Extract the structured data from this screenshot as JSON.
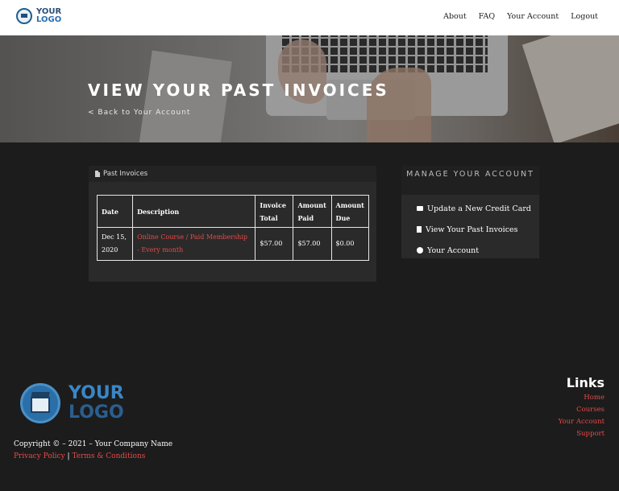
{
  "header": {
    "logo": {
      "line1": "YOUR",
      "line2": "LOGO"
    },
    "nav": [
      "About",
      "FAQ",
      "Your Account",
      "Logout"
    ]
  },
  "hero": {
    "title": "VIEW YOUR PAST INVOICES",
    "back_link": "< Back to Your Account"
  },
  "invoices": {
    "panel_title": "Past Invoices",
    "columns": {
      "date": "Date",
      "description": "Description",
      "invoice_total": "Invoice Total",
      "amount_paid": "Amount Paid",
      "amount_due": "Amount Due"
    },
    "rows": [
      {
        "date": "Dec 15, 2020",
        "description": "Online Course / Paid Membership - Every month",
        "invoice_total": "$57.00",
        "amount_paid": "$57.00",
        "amount_due": "$0.00"
      }
    ]
  },
  "manage": {
    "title": "MANAGE YOUR ACCOUNT",
    "items": [
      {
        "label": "Update a New Credit Card",
        "icon": "credit-card-icon"
      },
      {
        "label": "View Your Past Invoices",
        "icon": "file-icon"
      },
      {
        "label": "Your Account",
        "icon": "gear-icon"
      }
    ]
  },
  "footer": {
    "logo": {
      "line1": "YOUR",
      "line2": "LOGO"
    },
    "copyright": "Copyright © – 2021 – Your Company Name",
    "privacy": "Privacy Policy",
    "separator": "|",
    "terms": "Terms & Conditions",
    "links_title": "Links",
    "links": [
      "Home",
      "Courses",
      "Your Account",
      "Support"
    ]
  },
  "colors": {
    "accent": "#e64a4a",
    "page_bg": "#1c1c1c",
    "panel_bg": "#2a2a2a",
    "brand_blue": "#2c6fb0"
  }
}
